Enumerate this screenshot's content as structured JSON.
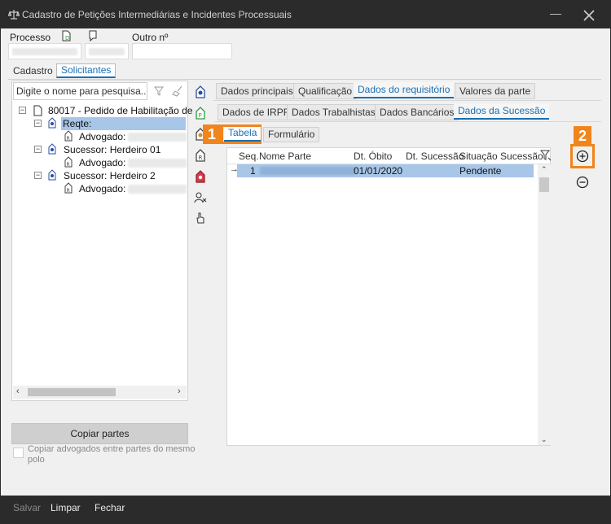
{
  "window": {
    "title": "Cadastro de Petições Intermediárias e Incidentes Processuais"
  },
  "header": {
    "processo_label": "Processo",
    "outro_label": "Outro nº"
  },
  "main_tabs": [
    {
      "label": "Cadastro"
    },
    {
      "label": "Solicitantes"
    }
  ],
  "left_panel": {
    "search_placeholder": "Digite o nome para pesquisa...",
    "tree": [
      {
        "label": "80017 - Pedido de Habilitação de"
      },
      {
        "label": "Reqte:"
      },
      {
        "label": "Advogado:"
      },
      {
        "label": "Sucessor: Herdeiro 01"
      },
      {
        "label": "Advogado:"
      },
      {
        "label": "Sucessor: Herdeiro 2"
      },
      {
        "label": "Advogado:"
      }
    ],
    "copy_button": "Copiar partes",
    "copy_lawyers_label": "Copiar advogados entre partes do mesmo polo"
  },
  "detail_tabs_row1": [
    {
      "label": "Dados principais"
    },
    {
      "label": "Qualificação"
    },
    {
      "label": "Dados do requisitório"
    },
    {
      "label": "Valores da parte"
    }
  ],
  "detail_tabs_row2": [
    {
      "label": "Dados de IRPF"
    },
    {
      "label": "Dados Trabalhistas"
    },
    {
      "label": "Dados Bancários"
    },
    {
      "label": "Dados da Sucessão"
    }
  ],
  "view_tabs": [
    {
      "label": "Tabela"
    },
    {
      "label": "Formulário"
    }
  ],
  "grid": {
    "columns": [
      "Seq.",
      "Nome Parte",
      "Dt. Óbito",
      "Dt. Sucessão",
      "Situação Sucessão"
    ],
    "rows": [
      {
        "seq": "1",
        "nome": "",
        "dt_obito": "01/01/2020",
        "dt_sucessao": "",
        "situacao": "Pendente"
      }
    ]
  },
  "callouts": {
    "one": "1",
    "two": "2"
  },
  "footer": {
    "salvar": "Salvar",
    "limpar": "Limpar",
    "fechar": "Fechar"
  },
  "colors": {
    "accent": "#1a6fb3",
    "callout": "#f0851e",
    "titlebar": "#2b2b2b",
    "selection": "#a7c6e8"
  }
}
